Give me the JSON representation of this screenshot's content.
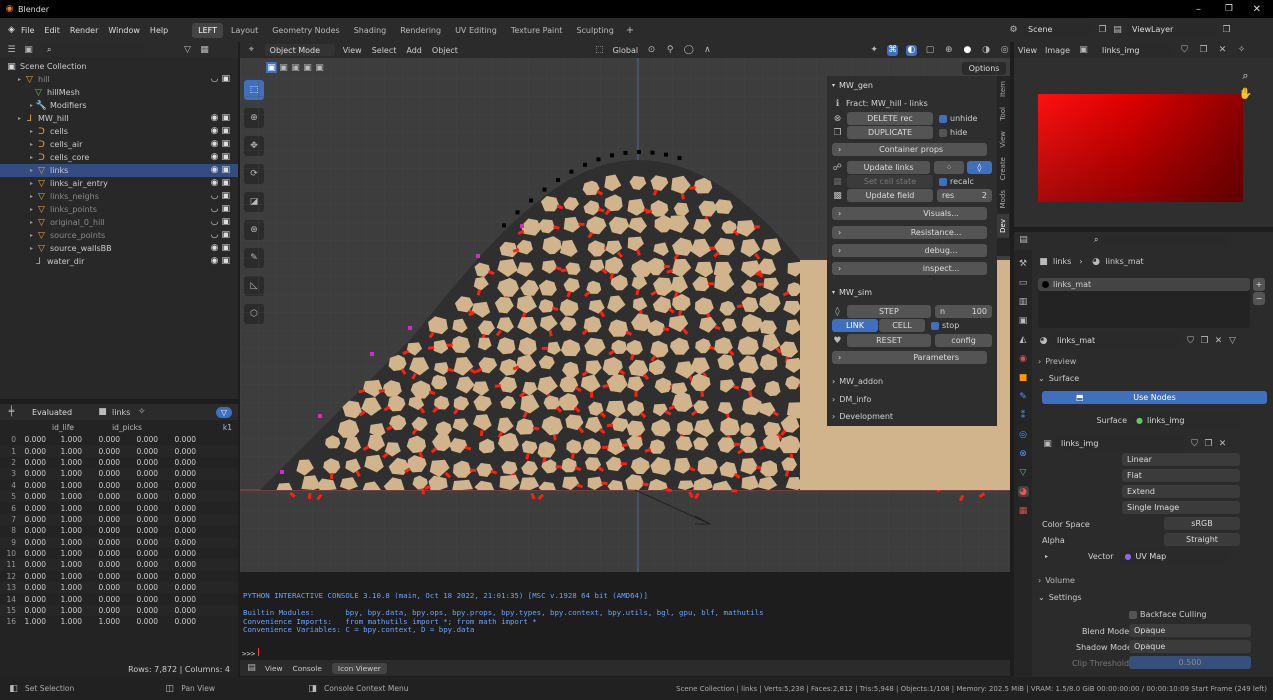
{
  "window": {
    "title": "Blender"
  },
  "menu": [
    "File",
    "Edit",
    "Render",
    "Window",
    "Help"
  ],
  "workspaces": [
    "LEFT",
    "Layout",
    "Geometry Nodes",
    "Shading",
    "Rendering",
    "UV Editing",
    "Texture Paint",
    "Sculpting"
  ],
  "scene": "Scene",
  "view_layer": "ViewLayer",
  "outliner": {
    "root": "Scene Collection",
    "items": [
      {
        "name": "hill",
        "depth": 1,
        "dim": true,
        "icon": "mesh-icon"
      },
      {
        "name": "hillMesh",
        "depth": 2,
        "dim": false,
        "icon": "mesh-data-icon"
      },
      {
        "name": "Modifiers",
        "depth": 2,
        "dim": false,
        "icon": "wrench-icon"
      },
      {
        "name": "MW_hill",
        "depth": 1,
        "dim": false,
        "icon": "empty-icon"
      },
      {
        "name": "cells",
        "depth": 2,
        "dim": false,
        "icon": "curve-icon"
      },
      {
        "name": "cells_air",
        "depth": 2,
        "dim": false,
        "icon": "curve-icon"
      },
      {
        "name": "cells_core",
        "depth": 2,
        "dim": false,
        "icon": "curve-icon"
      },
      {
        "name": "links",
        "depth": 2,
        "dim": false,
        "icon": "mesh-icon"
      },
      {
        "name": "links_air_entry",
        "depth": 2,
        "dim": false,
        "icon": "mesh-icon"
      },
      {
        "name": "links_neighs",
        "depth": 2,
        "dim": true,
        "icon": "mesh-icon"
      },
      {
        "name": "links_points",
        "depth": 2,
        "dim": true,
        "icon": "mesh-icon"
      },
      {
        "name": "original_0_hill",
        "depth": 2,
        "dim": true,
        "icon": "mesh-icon"
      },
      {
        "name": "source_points",
        "depth": 2,
        "dim": true,
        "icon": "mesh-icon"
      },
      {
        "name": "source_wallsBB",
        "depth": 2,
        "dim": false,
        "icon": "mesh-icon"
      },
      {
        "name": "water_dir",
        "depth": 2,
        "dim": false,
        "icon": "empty-icon"
      }
    ]
  },
  "spreadsheet": {
    "mode": "Evaluated",
    "object": "links",
    "columns": [
      "id_life",
      "id_picks",
      "k1"
    ],
    "rows": [
      [
        "0",
        "0.000",
        "1.000",
        "0.000",
        "0.000",
        "0.000"
      ],
      [
        "1",
        "0.000",
        "1.000",
        "0.000",
        "0.000",
        "0.000"
      ],
      [
        "2",
        "0.000",
        "1.000",
        "0.000",
        "0.000",
        "0.000"
      ],
      [
        "3",
        "0.000",
        "1.000",
        "0.000",
        "0.000",
        "0.000"
      ],
      [
        "4",
        "0.000",
        "1.000",
        "0.000",
        "0.000",
        "0.000"
      ],
      [
        "5",
        "0.000",
        "1.000",
        "0.000",
        "0.000",
        "0.000"
      ],
      [
        "6",
        "0.000",
        "1.000",
        "0.000",
        "0.000",
        "0.000"
      ],
      [
        "7",
        "0.000",
        "1.000",
        "0.000",
        "0.000",
        "0.000"
      ],
      [
        "8",
        "0.000",
        "1.000",
        "0.000",
        "0.000",
        "0.000"
      ],
      [
        "9",
        "0.000",
        "1.000",
        "0.000",
        "0.000",
        "0.000"
      ],
      [
        "10",
        "0.000",
        "1.000",
        "0.000",
        "0.000",
        "0.000"
      ],
      [
        "11",
        "0.000",
        "1.000",
        "0.000",
        "0.000",
        "0.000"
      ],
      [
        "12",
        "0.000",
        "1.000",
        "0.000",
        "0.000",
        "0.000"
      ],
      [
        "13",
        "0.000",
        "1.000",
        "0.000",
        "0.000",
        "0.000"
      ],
      [
        "14",
        "0.000",
        "1.000",
        "0.000",
        "0.000",
        "0.000"
      ],
      [
        "15",
        "0.000",
        "1.000",
        "0.000",
        "0.000",
        "0.000"
      ],
      [
        "16",
        "1.000",
        "1.000",
        "1.000",
        "0.000",
        "0.000"
      ]
    ],
    "footer": "Rows: 7,872  |  Columns: 4"
  },
  "viewport": {
    "mode": "Object Mode",
    "menus": [
      "View",
      "Select",
      "Add",
      "Object"
    ],
    "transform": "Global",
    "options": "Options"
  },
  "npanel": {
    "tabs": [
      "Item",
      "Tool",
      "View",
      "Create",
      "Mods",
      "Dev"
    ],
    "gen_title": "MW_gen",
    "fract": "Fract: MW_hill - links",
    "delete": "DELETE rec",
    "unhide": "unhide",
    "duplicate": "DUPLICATE",
    "hide": "hide",
    "container": "Container props",
    "update_links": "Update links",
    "set_cell": "Set cell state",
    "recalc": "recalc",
    "update_field": "Update field",
    "res": "res",
    "res_val": "2",
    "visuals": "Visuals...",
    "resistance": "Resistance...",
    "debug": "debug...",
    "inspect": "inspect...",
    "sim_title": "MW_sim",
    "step": "STEP",
    "n": "n",
    "n_val": "100",
    "link": "LINK",
    "cell": "CELL",
    "stop": "stop",
    "reset": "RESET",
    "config": "config",
    "parameters": "Parameters",
    "addon": "MW_addon",
    "dm_info": "DM_info",
    "development": "Development"
  },
  "console": {
    "lines": [
      "PYTHON INTERACTIVE CONSOLE 3.10.8 (main, Oct 18 2022, 21:01:35) [MSC v.1928 64 bit (AMD64)]",
      "",
      "Builtin Modules:       bpy, bpy.data, bpy.ops, bpy.props, bpy.types, bpy.context, bpy.utils, bgl, gpu, blf, mathutils",
      "Convenience Imports:   from mathutils import *; from math import *",
      "Convenience Variables: C = bpy.context, D = bpy.data"
    ],
    "prompt": ">>>",
    "tabs": [
      "View",
      "Console",
      "Icon Viewer"
    ]
  },
  "image_editor": {
    "menus": [
      "View",
      "Image"
    ],
    "image": "links_img"
  },
  "properties": {
    "breadcrumb_obj": "links",
    "breadcrumb_mat": "links_mat",
    "slot": "links_mat",
    "material": "links_mat",
    "preview": "Preview",
    "surface_hdr": "Surface",
    "use_nodes": "Use Nodes",
    "surface_label": "Surface",
    "surface_val": "links_img",
    "image": "links_img",
    "interp": "Linear",
    "proj": "Flat",
    "ext": "Extend",
    "source": "Single Image",
    "colorspace_label": "Color Space",
    "colorspace": "sRGB",
    "alpha_label": "Alpha",
    "alpha": "Straight",
    "vector_label": "Vector",
    "vector": "UV Map",
    "volume": "Volume",
    "settings": "Settings",
    "backface": "Backface Culling",
    "blend_label": "Blend Mode",
    "blend": "Opaque",
    "shadow_label": "Shadow Mode",
    "shadow": "Opaque",
    "clip_label": "Clip Threshold",
    "clip": "0.500"
  },
  "status": {
    "left1": "Set Selection",
    "left2": "Pan View",
    "left3": "Console Context Menu",
    "right": "Scene Collection | links | Verts:5,238 | Faces:2,812 | Tris:5,948 | Objects:1/108 | Memory: 202.5 MiB | VRAM: 1.5/8.0 GiB  00:00:00:00 / 00:00:10:09  Start Frame (249 left)"
  },
  "colors": {
    "accent": "#3f6fbf",
    "cell_fill": "#d1b48c",
    "link_red": "#ff2010",
    "viewport_bg": "#3d3d3d"
  }
}
